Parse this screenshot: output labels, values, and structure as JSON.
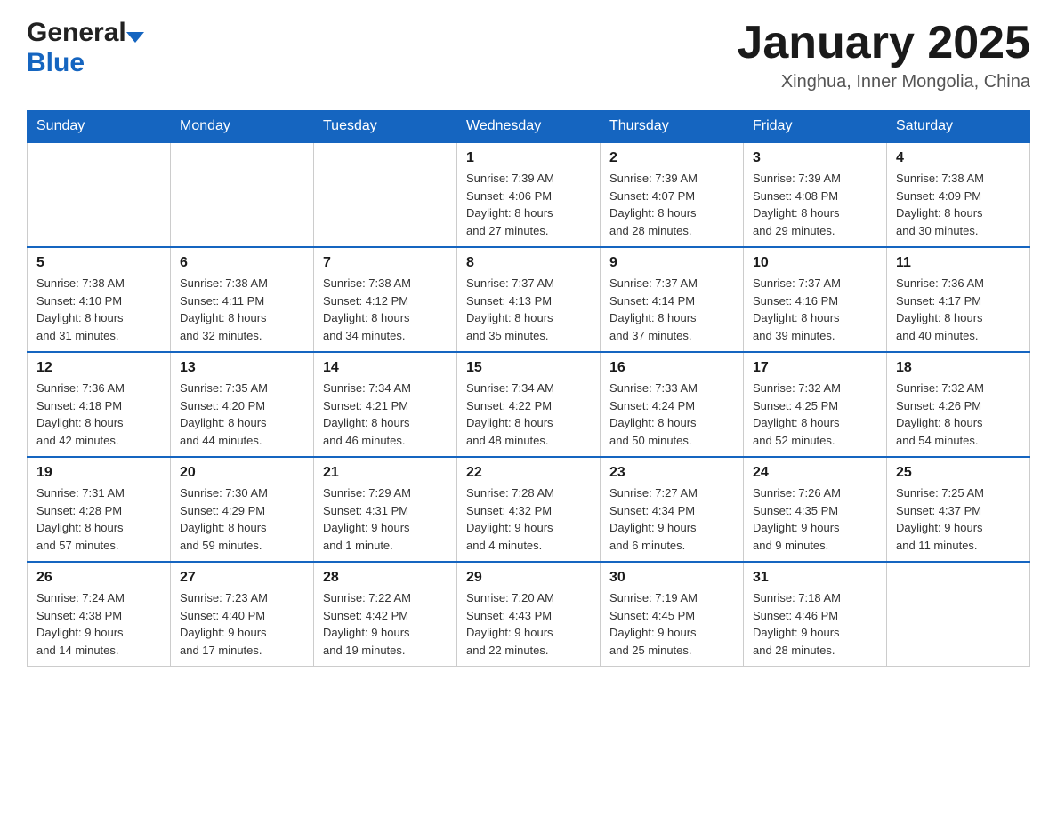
{
  "header": {
    "logo_general": "General",
    "logo_blue": "Blue",
    "month_title": "January 2025",
    "location": "Xinghua, Inner Mongolia, China"
  },
  "days_of_week": [
    "Sunday",
    "Monday",
    "Tuesday",
    "Wednesday",
    "Thursday",
    "Friday",
    "Saturday"
  ],
  "weeks": [
    [
      {
        "day": "",
        "info": ""
      },
      {
        "day": "",
        "info": ""
      },
      {
        "day": "",
        "info": ""
      },
      {
        "day": "1",
        "info": "Sunrise: 7:39 AM\nSunset: 4:06 PM\nDaylight: 8 hours\nand 27 minutes."
      },
      {
        "day": "2",
        "info": "Sunrise: 7:39 AM\nSunset: 4:07 PM\nDaylight: 8 hours\nand 28 minutes."
      },
      {
        "day": "3",
        "info": "Sunrise: 7:39 AM\nSunset: 4:08 PM\nDaylight: 8 hours\nand 29 minutes."
      },
      {
        "day": "4",
        "info": "Sunrise: 7:38 AM\nSunset: 4:09 PM\nDaylight: 8 hours\nand 30 minutes."
      }
    ],
    [
      {
        "day": "5",
        "info": "Sunrise: 7:38 AM\nSunset: 4:10 PM\nDaylight: 8 hours\nand 31 minutes."
      },
      {
        "day": "6",
        "info": "Sunrise: 7:38 AM\nSunset: 4:11 PM\nDaylight: 8 hours\nand 32 minutes."
      },
      {
        "day": "7",
        "info": "Sunrise: 7:38 AM\nSunset: 4:12 PM\nDaylight: 8 hours\nand 34 minutes."
      },
      {
        "day": "8",
        "info": "Sunrise: 7:37 AM\nSunset: 4:13 PM\nDaylight: 8 hours\nand 35 minutes."
      },
      {
        "day": "9",
        "info": "Sunrise: 7:37 AM\nSunset: 4:14 PM\nDaylight: 8 hours\nand 37 minutes."
      },
      {
        "day": "10",
        "info": "Sunrise: 7:37 AM\nSunset: 4:16 PM\nDaylight: 8 hours\nand 39 minutes."
      },
      {
        "day": "11",
        "info": "Sunrise: 7:36 AM\nSunset: 4:17 PM\nDaylight: 8 hours\nand 40 minutes."
      }
    ],
    [
      {
        "day": "12",
        "info": "Sunrise: 7:36 AM\nSunset: 4:18 PM\nDaylight: 8 hours\nand 42 minutes."
      },
      {
        "day": "13",
        "info": "Sunrise: 7:35 AM\nSunset: 4:20 PM\nDaylight: 8 hours\nand 44 minutes."
      },
      {
        "day": "14",
        "info": "Sunrise: 7:34 AM\nSunset: 4:21 PM\nDaylight: 8 hours\nand 46 minutes."
      },
      {
        "day": "15",
        "info": "Sunrise: 7:34 AM\nSunset: 4:22 PM\nDaylight: 8 hours\nand 48 minutes."
      },
      {
        "day": "16",
        "info": "Sunrise: 7:33 AM\nSunset: 4:24 PM\nDaylight: 8 hours\nand 50 minutes."
      },
      {
        "day": "17",
        "info": "Sunrise: 7:32 AM\nSunset: 4:25 PM\nDaylight: 8 hours\nand 52 minutes."
      },
      {
        "day": "18",
        "info": "Sunrise: 7:32 AM\nSunset: 4:26 PM\nDaylight: 8 hours\nand 54 minutes."
      }
    ],
    [
      {
        "day": "19",
        "info": "Sunrise: 7:31 AM\nSunset: 4:28 PM\nDaylight: 8 hours\nand 57 minutes."
      },
      {
        "day": "20",
        "info": "Sunrise: 7:30 AM\nSunset: 4:29 PM\nDaylight: 8 hours\nand 59 minutes."
      },
      {
        "day": "21",
        "info": "Sunrise: 7:29 AM\nSunset: 4:31 PM\nDaylight: 9 hours\nand 1 minute."
      },
      {
        "day": "22",
        "info": "Sunrise: 7:28 AM\nSunset: 4:32 PM\nDaylight: 9 hours\nand 4 minutes."
      },
      {
        "day": "23",
        "info": "Sunrise: 7:27 AM\nSunset: 4:34 PM\nDaylight: 9 hours\nand 6 minutes."
      },
      {
        "day": "24",
        "info": "Sunrise: 7:26 AM\nSunset: 4:35 PM\nDaylight: 9 hours\nand 9 minutes."
      },
      {
        "day": "25",
        "info": "Sunrise: 7:25 AM\nSunset: 4:37 PM\nDaylight: 9 hours\nand 11 minutes."
      }
    ],
    [
      {
        "day": "26",
        "info": "Sunrise: 7:24 AM\nSunset: 4:38 PM\nDaylight: 9 hours\nand 14 minutes."
      },
      {
        "day": "27",
        "info": "Sunrise: 7:23 AM\nSunset: 4:40 PM\nDaylight: 9 hours\nand 17 minutes."
      },
      {
        "day": "28",
        "info": "Sunrise: 7:22 AM\nSunset: 4:42 PM\nDaylight: 9 hours\nand 19 minutes."
      },
      {
        "day": "29",
        "info": "Sunrise: 7:20 AM\nSunset: 4:43 PM\nDaylight: 9 hours\nand 22 minutes."
      },
      {
        "day": "30",
        "info": "Sunrise: 7:19 AM\nSunset: 4:45 PM\nDaylight: 9 hours\nand 25 minutes."
      },
      {
        "day": "31",
        "info": "Sunrise: 7:18 AM\nSunset: 4:46 PM\nDaylight: 9 hours\nand 28 minutes."
      },
      {
        "day": "",
        "info": ""
      }
    ]
  ]
}
